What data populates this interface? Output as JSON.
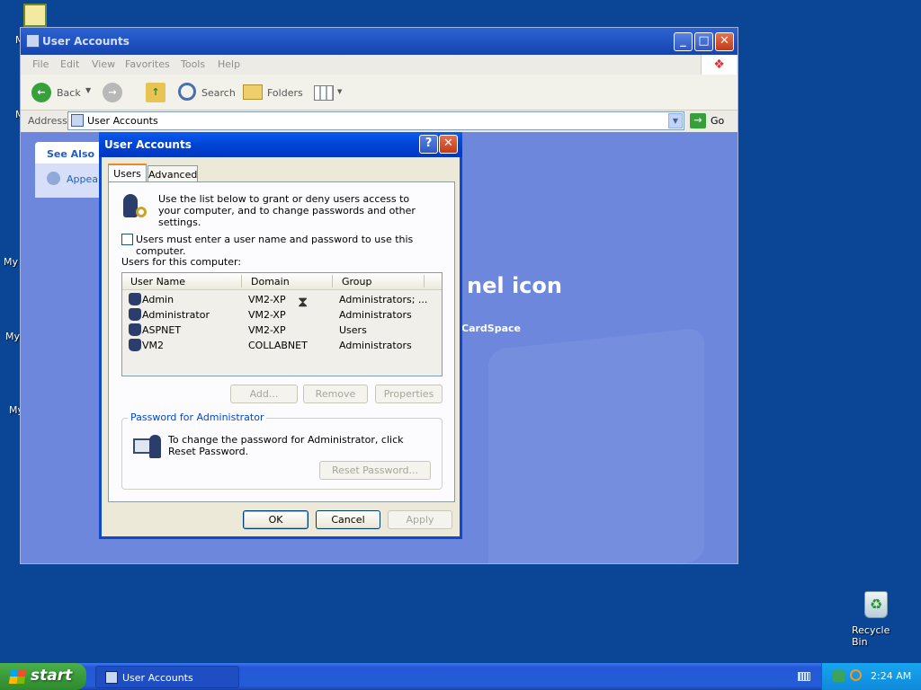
{
  "desktop": {
    "icons": [
      {
        "label": "My",
        "name": "desktop-icon-my-documents"
      },
      {
        "label": "My",
        "name": "desktop-icon-my-computer"
      },
      {
        "label": "My I",
        "name": "desktop-icon-my-network"
      },
      {
        "label": "My",
        "name": "desktop-icon-my-network-places"
      },
      {
        "label": "My",
        "name": "desktop-icon-my-music"
      }
    ],
    "recycle_bin": "Recycle Bin"
  },
  "explorer": {
    "title": "User Accounts",
    "menu": [
      "File",
      "Edit",
      "View",
      "Favorites",
      "Tools",
      "Help"
    ],
    "toolbar": {
      "back": "Back",
      "search": "Search",
      "folders": "Folders"
    },
    "address_label": "Address",
    "address_value": "User Accounts",
    "go": "Go",
    "see_also": "See Also",
    "see_also_item": "Appear",
    "panel_heading": "nel icon",
    "panel_link": "CardSpace"
  },
  "dialog": {
    "title": "User Accounts",
    "tabs": [
      "Users",
      "Advanced"
    ],
    "intro": "Use the list below to grant or deny users access to your computer, and to change passwords and other settings.",
    "checkbox_label": "Users must enter a user name and password to use this computer.",
    "checkbox_checked": false,
    "users_label": "Users for this computer:",
    "columns": [
      "User Name",
      "Domain",
      "Group"
    ],
    "users": [
      {
        "name": "Admin",
        "domain": "VM2-XP",
        "group": "Administrators; ..."
      },
      {
        "name": "Administrator",
        "domain": "VM2-XP",
        "group": "Administrators"
      },
      {
        "name": "ASPNET",
        "domain": "VM2-XP",
        "group": "Users"
      },
      {
        "name": "VM2",
        "domain": "COLLABNET",
        "group": "Administrators"
      }
    ],
    "buttons": {
      "add": "Add...",
      "remove": "Remove",
      "properties": "Properties"
    },
    "password_group": "Password for Administrator",
    "password_text": "To change the password for Administrator, click Reset Password.",
    "reset": "Reset Password...",
    "ok": "OK",
    "cancel": "Cancel",
    "apply": "Apply"
  },
  "taskbar": {
    "start": "start",
    "task": "User Accounts",
    "clock": "2:24 AM"
  },
  "colors": {
    "desktop": "#0a4596",
    "xp_blue_title": "#0044d6",
    "start_green": "#3a9a3a"
  }
}
